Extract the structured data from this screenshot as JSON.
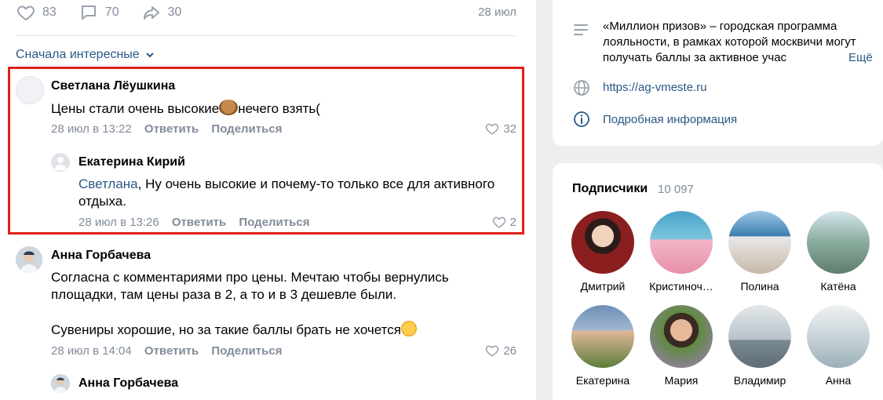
{
  "post": {
    "likes": "83",
    "comments": "70",
    "shares": "30",
    "date": "28 июл",
    "sort_label": "Сначала интересные"
  },
  "comments": [
    {
      "author": "Светлана Лёушкина",
      "text": "Цены стали очень высокие",
      "text_after_emoji": "нечего взять(",
      "date": "28 июл в 13:22",
      "reply": "Ответить",
      "share": "Поделиться",
      "likes": "32"
    },
    {
      "author": "Екатерина Кирий",
      "mention": "Светлана",
      "text": ", Ну очень высокие и почему-то только все для активного отдыха.",
      "date": "28 июл в 13:26",
      "reply": "Ответить",
      "share": "Поделиться",
      "likes": "2"
    },
    {
      "author": "Анна Горбачева",
      "text1": "Согласна с комментариями про цены. Мечтаю чтобы вернулись площадки, там цены раза в 2, а то и в 3 дешевле были.",
      "text2": "Сувениры хорошие, но за такие баллы брать не хочется",
      "date": "28 июл в 14:04",
      "reply": "Ответить",
      "share": "Поделиться",
      "likes": "26"
    },
    {
      "author": "Анна Горбачева"
    }
  ],
  "info": {
    "description": "«Миллион призов» – городская программа лояльности, в рамках которой москвичи могут получать баллы за активное учас",
    "more": "Ещё",
    "link": "https://ag-vmeste.ru",
    "details": "Подробная информация"
  },
  "subscribers": {
    "title": "Подписчики",
    "count": "10 097",
    "people": [
      {
        "name": "Дмитрий",
        "color": "#8b1e1e"
      },
      {
        "name": "Кристиноч…",
        "color": "#4aa3c7"
      },
      {
        "name": "Полина",
        "color": "#3d7fb0"
      },
      {
        "name": "Катёна",
        "color": "#8fb1a3"
      },
      {
        "name": "Екатерина",
        "color": "#6f8fb8"
      },
      {
        "name": "Мария",
        "color": "#5e8b3e"
      },
      {
        "name": "Владимир",
        "color": "#b8c3c9"
      },
      {
        "name": "Анна",
        "color": "#c9d4d8"
      }
    ]
  },
  "colors": {
    "link": "#2a5885",
    "muted": "#818c99",
    "highlight": "#e0201b"
  }
}
